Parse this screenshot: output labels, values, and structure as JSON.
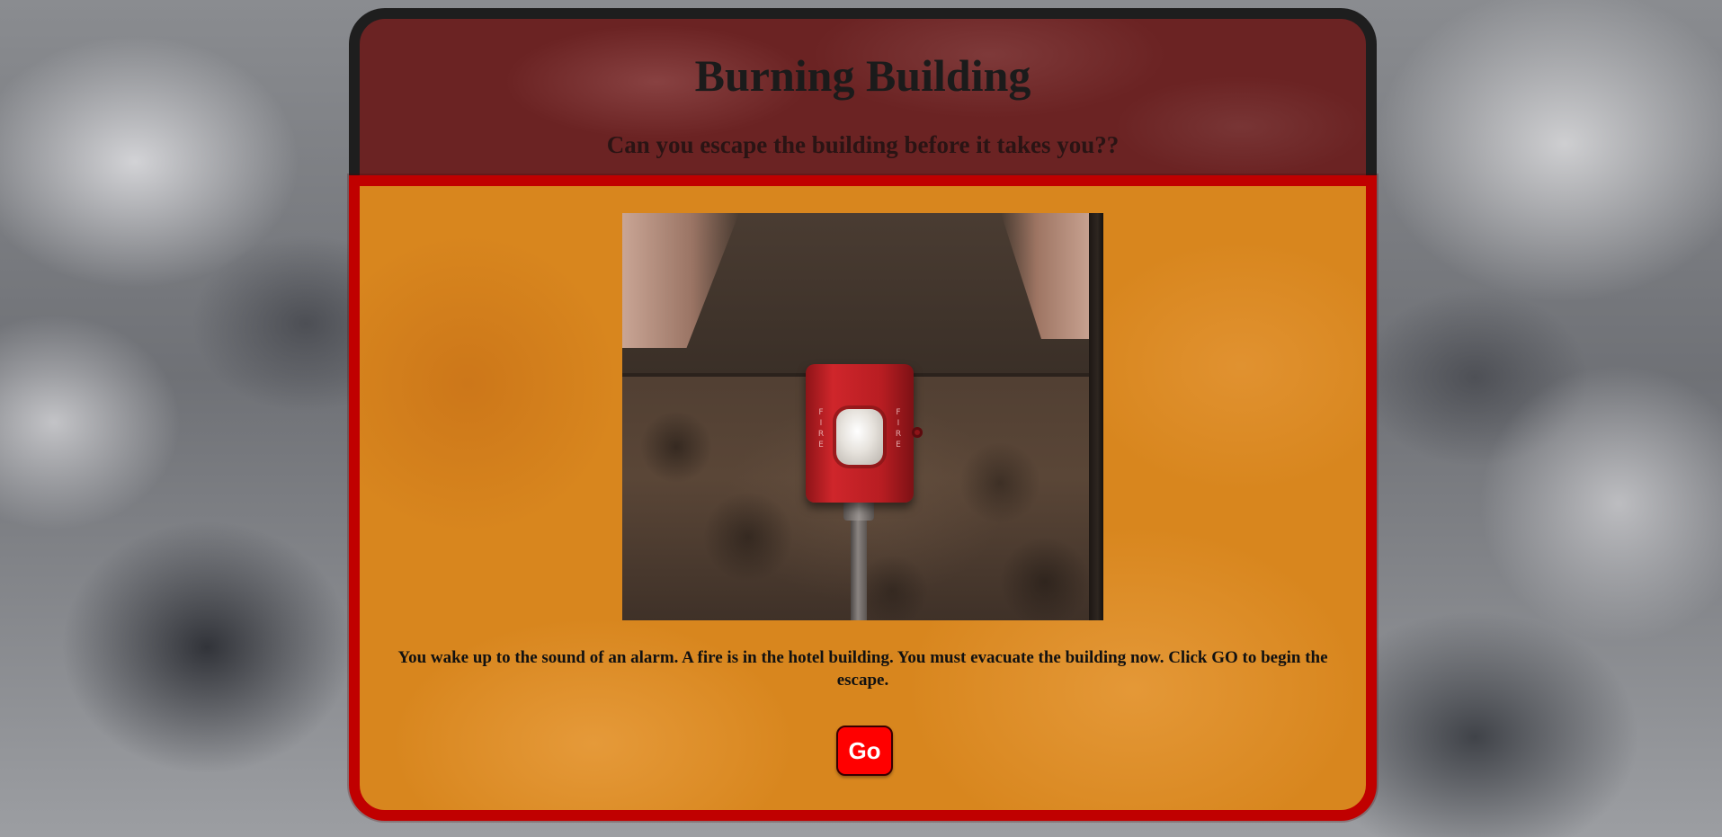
{
  "header": {
    "title": "Burning Building",
    "subtitle": "Can you escape the building before it takes you??"
  },
  "scene": {
    "image_alt": "Red fire alarm mounted on a concrete wall",
    "alarm_side_text_left": "FIRE",
    "alarm_side_text_right": "FIRE"
  },
  "story": {
    "text": "You wake up to the sound of an alarm. A fire is in the hotel building. You must evacuate the building now. Click GO to begin the escape."
  },
  "controls": {
    "go_label": "Go"
  },
  "colors": {
    "header_bg": "#6b2323",
    "header_border": "#1e1e1e",
    "panel_bg": "#d8861e",
    "panel_border": "#c00000",
    "button_bg": "#ff0000",
    "button_text": "#ffffff"
  },
  "icons": {
    "alarm": "fire-alarm-icon"
  }
}
